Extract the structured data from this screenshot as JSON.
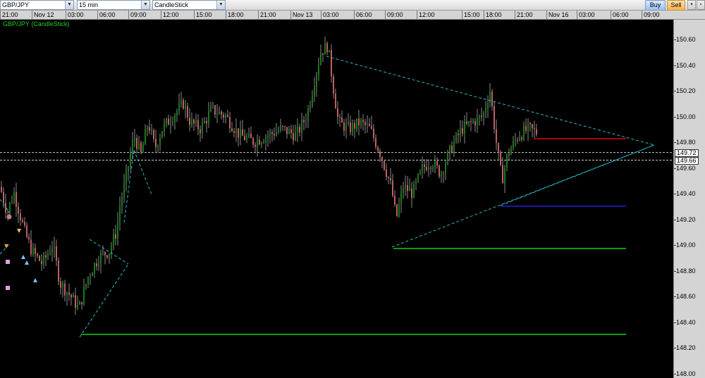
{
  "toolbar": {
    "symbol": "GBP/JPY",
    "interval": "15 min",
    "chart_type": "CandleStick",
    "buy_label": "Buy",
    "sell_label": "Sell",
    "dropdown_icon": "chevron-down-icon"
  },
  "chart_title": "GBP/JPY (CandleStick)",
  "time_axis": [
    "21:00",
    "Nov 12",
    "03:00",
    "06:00",
    "09:00",
    "12:00",
    "15:00",
    "18:00",
    "21:00",
    "Nov 13",
    "03:00",
    "06:00",
    "09:00",
    "12:00",
    "15:00",
    "18:00",
    "21:00",
    "Nov 16",
    "03:00",
    "06:00",
    "09:00"
  ],
  "price_axis": [
    "150.60",
    "150.40",
    "150.20",
    "150.00",
    "149.80",
    "149.60",
    "149.40",
    "149.20",
    "149.00",
    "148.80",
    "148.60",
    "148.40",
    "148.20",
    "148.00"
  ],
  "price_markers": [
    "149.72",
    "149.66"
  ],
  "colors": {
    "up_candle": "#1a7a1a",
    "down_candle": "#c06060",
    "trendline": "#2ab8c8",
    "red_level": "#e00000",
    "blue_level": "#2020e0",
    "green_level": "#10d010"
  }
}
